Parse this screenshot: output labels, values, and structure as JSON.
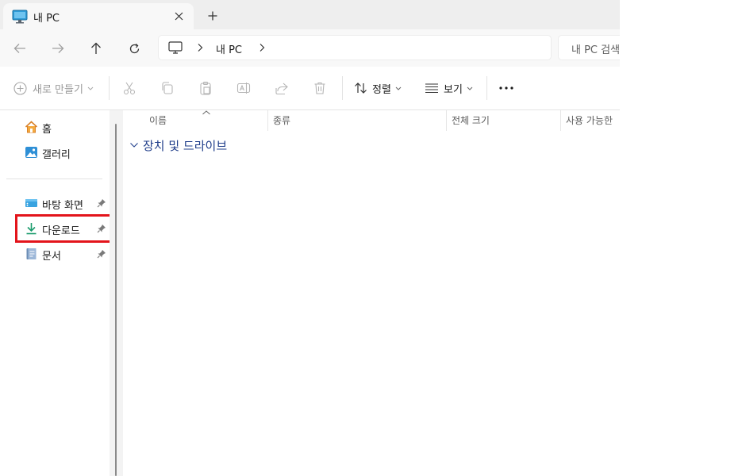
{
  "tab": {
    "title": "내 PC",
    "close_glyph": "✕",
    "new_glyph": "+"
  },
  "nav": {
    "back": "back-arrow-icon",
    "forward": "forward-arrow-icon",
    "up": "up-arrow-icon",
    "refresh": "refresh-icon"
  },
  "address": {
    "segments": [
      "내 PC"
    ]
  },
  "search": {
    "placeholder": "내 PC 검색"
  },
  "toolbar": {
    "new_label": "새로 만들기",
    "sort_label": "정렬",
    "view_label": "보기",
    "more_glyph": "···"
  },
  "sidebar": {
    "items": [
      {
        "label": "홈",
        "icon": "home-icon"
      },
      {
        "label": "갤러리",
        "icon": "gallery-icon"
      }
    ],
    "pinned": [
      {
        "label": "바탕 화면",
        "icon": "desktop-folder-icon"
      },
      {
        "label": "다운로드",
        "icon": "download-icon"
      },
      {
        "label": "문서",
        "icon": "documents-icon"
      }
    ]
  },
  "columns": [
    "이름",
    "종류",
    "전체 크기",
    "사용 가능한"
  ],
  "group": {
    "label": "장치 및 드라이브"
  },
  "colors": {
    "accent": "#0067c0",
    "highlight": "#e3141b",
    "group_text": "#1f3d8a"
  }
}
